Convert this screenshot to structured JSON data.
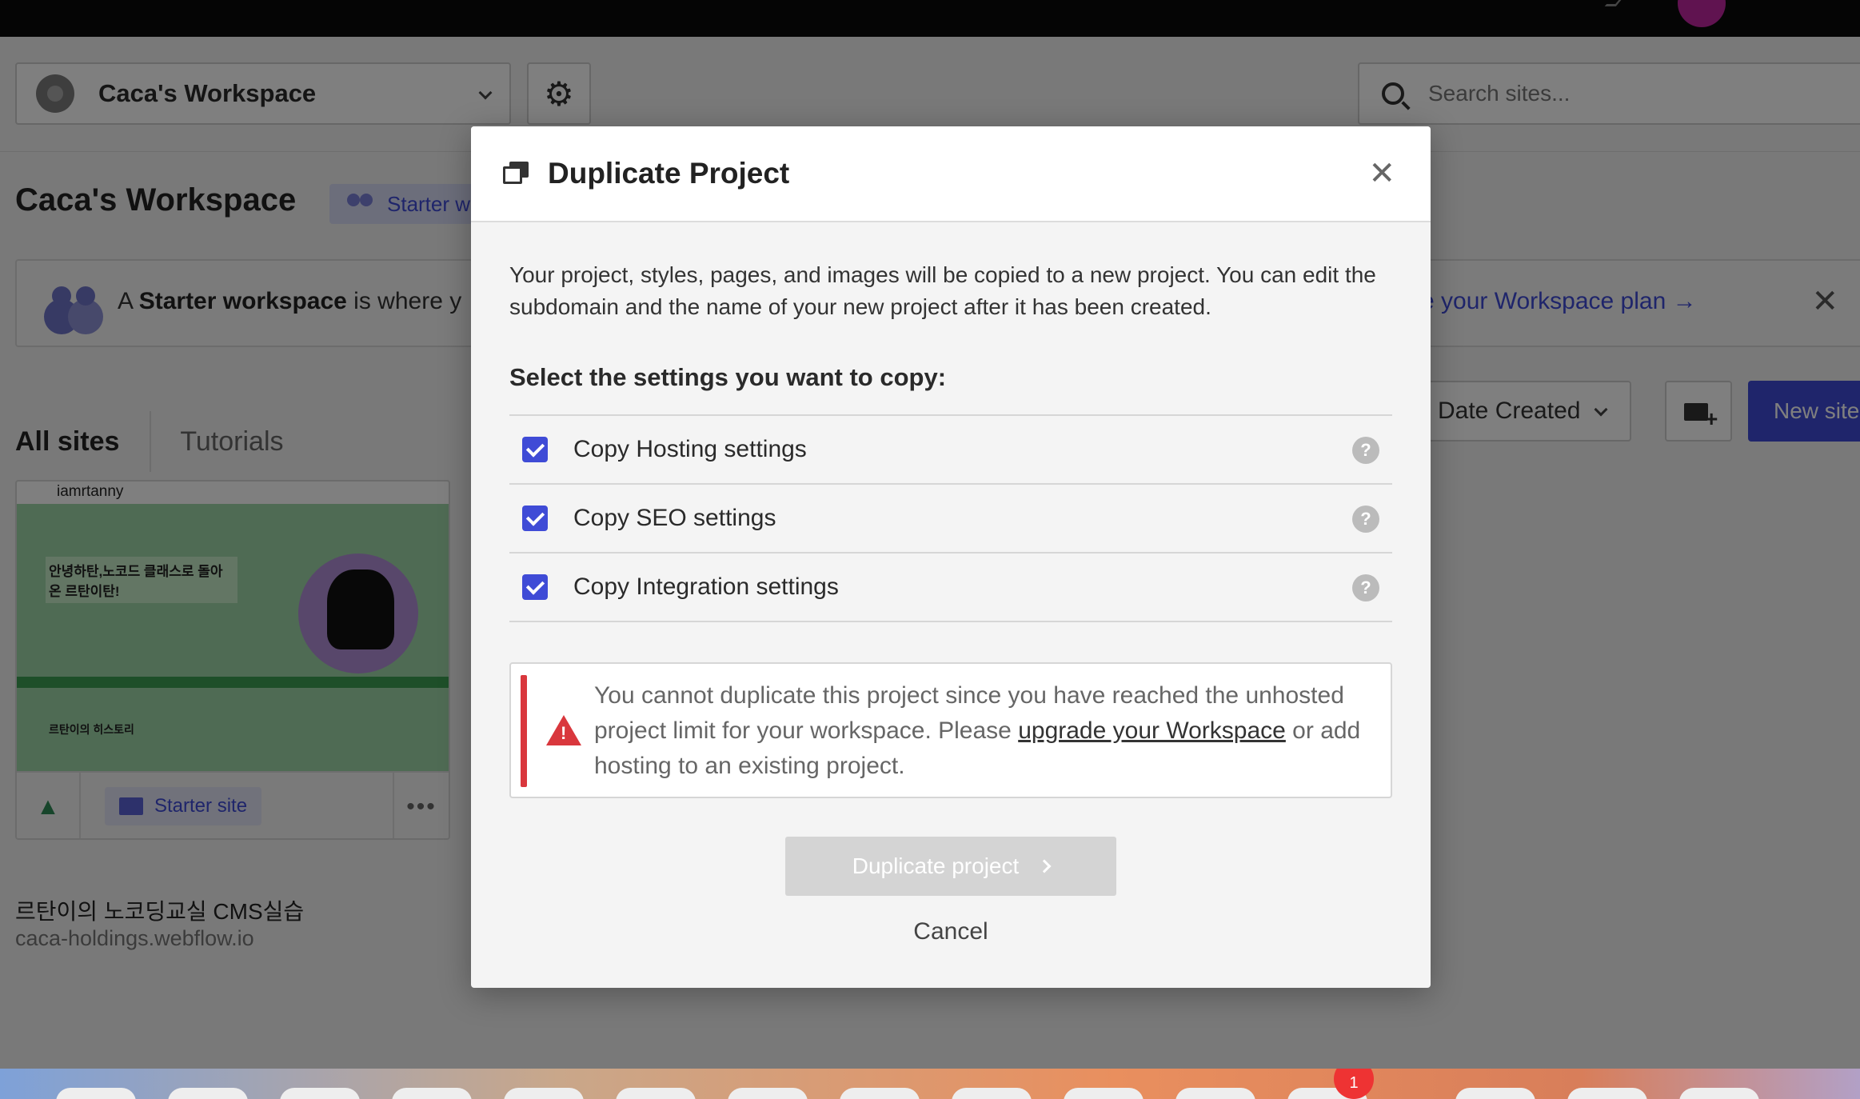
{
  "workspace": {
    "name": "Caca's Workspace",
    "title": "Caca's Workspace",
    "plan_badge": "Starter w"
  },
  "search": {
    "placeholder": "Search sites..."
  },
  "banner": {
    "prefix": "A ",
    "bold": "Starter workspace",
    "suffix": " is where y",
    "link": "e your Workspace plan →"
  },
  "tabs": {
    "all": "All sites",
    "tutorials": "Tutorials"
  },
  "sort": {
    "selected": "Date Created"
  },
  "new_site_label": "New site",
  "site_card": {
    "thumb_brand": "iamrtanny",
    "thumb_heading": "안녕하탄,노코드 클래스로 돌아온 르탄이탄!",
    "thumb_sub": "르탄이의 히스토리",
    "badge": "Starter site",
    "name": "르탄이의 노코딩교실 CMS실습",
    "domain": "caca-holdings.webflow.io"
  },
  "modal": {
    "title": "Duplicate Project",
    "intro": "Your project, styles, pages, and images will be copied to a new project. You can edit the subdomain and the name of your new project after it has been created.",
    "settings_heading": "Select the settings you want to copy:",
    "settings": [
      {
        "label": "Copy Hosting settings",
        "checked": true
      },
      {
        "label": "Copy SEO settings",
        "checked": true
      },
      {
        "label": "Copy Integration settings",
        "checked": true
      }
    ],
    "warning": {
      "text_before": "You cannot duplicate this project since you have reached the unhosted project limit for your workspace. Please ",
      "link": "upgrade your Workspace",
      "text_after": " or add hosting to an existing project."
    },
    "primary_button": "Duplicate project",
    "cancel": "Cancel"
  },
  "dock": {
    "badge_count": "1"
  },
  "colors": {
    "accent": "#3f4bd6",
    "danger": "#d9373d",
    "disabled": "#d4d4d4"
  }
}
